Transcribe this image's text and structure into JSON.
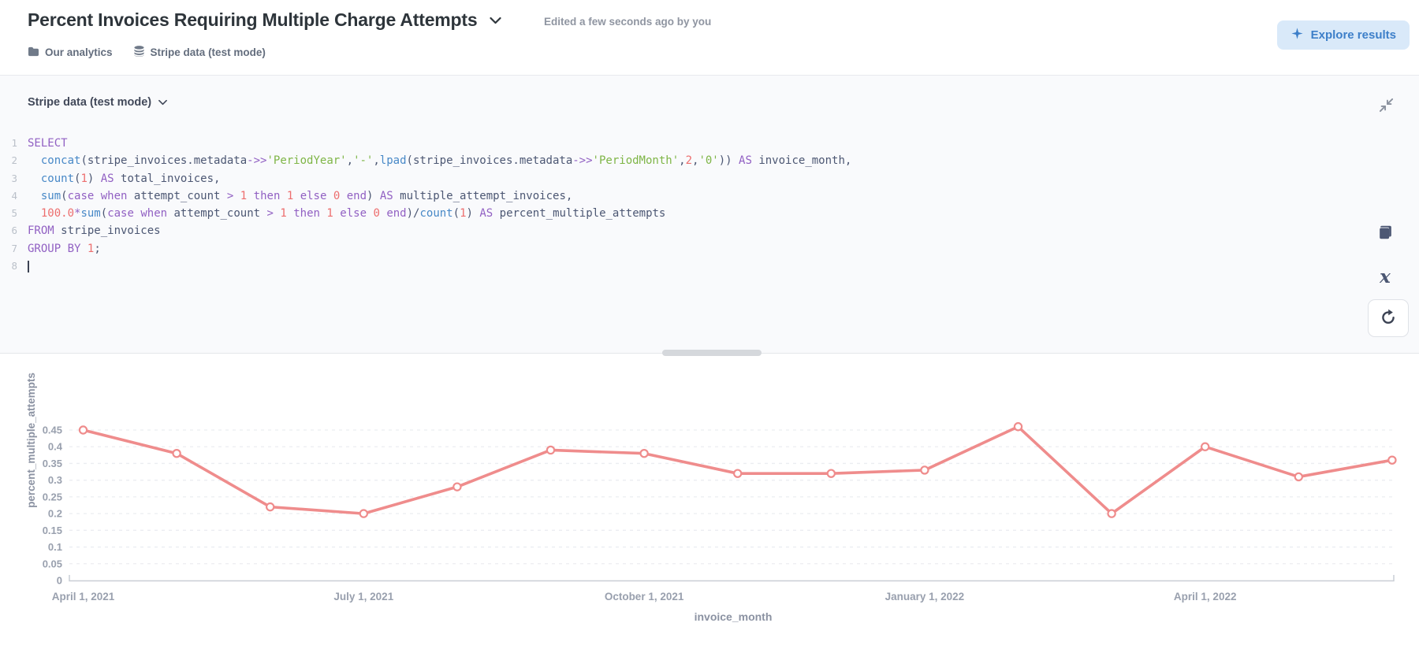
{
  "header": {
    "title": "Percent Invoices Requiring Multiple Charge Attempts",
    "edited_note": "Edited a few seconds ago by you",
    "explore_button_label": "Explore results",
    "breadcrumbs": [
      {
        "icon": "folder",
        "label": "Our analytics"
      },
      {
        "icon": "database",
        "label": "Stripe data (test mode)"
      }
    ]
  },
  "editor": {
    "datasource_label": "Stripe data (test mode)",
    "sql_lines": [
      [
        [
          "k",
          "SELECT"
        ]
      ],
      [
        [
          "p",
          "  "
        ],
        [
          "f",
          "concat"
        ],
        [
          "p",
          "("
        ],
        [
          "p",
          "stripe_invoices.metadata"
        ],
        [
          "o",
          "->>"
        ],
        [
          "s",
          "'PeriodYear'"
        ],
        [
          "p",
          ","
        ],
        [
          "s",
          "'-'"
        ],
        [
          "p",
          ","
        ],
        [
          "f",
          "lpad"
        ],
        [
          "p",
          "("
        ],
        [
          "p",
          "stripe_invoices.metadata"
        ],
        [
          "o",
          "->>"
        ],
        [
          "s",
          "'PeriodMonth'"
        ],
        [
          "p",
          ","
        ],
        [
          "n",
          "2"
        ],
        [
          "p",
          ","
        ],
        [
          "s",
          "'0'"
        ],
        [
          "p",
          ")) "
        ],
        [
          "k",
          "AS"
        ],
        [
          "p",
          " invoice_month,"
        ]
      ],
      [
        [
          "p",
          "  "
        ],
        [
          "f",
          "count"
        ],
        [
          "p",
          "("
        ],
        [
          "n",
          "1"
        ],
        [
          "p",
          ") "
        ],
        [
          "k",
          "AS"
        ],
        [
          "p",
          " total_invoices,"
        ]
      ],
      [
        [
          "p",
          "  "
        ],
        [
          "f",
          "sum"
        ],
        [
          "p",
          "("
        ],
        [
          "k",
          "case"
        ],
        [
          "p",
          " "
        ],
        [
          "k",
          "when"
        ],
        [
          "p",
          " attempt_count "
        ],
        [
          "o",
          ">"
        ],
        [
          "p",
          " "
        ],
        [
          "n",
          "1"
        ],
        [
          "p",
          " "
        ],
        [
          "k",
          "then"
        ],
        [
          "p",
          " "
        ],
        [
          "n",
          "1"
        ],
        [
          "p",
          " "
        ],
        [
          "k",
          "else"
        ],
        [
          "p",
          " "
        ],
        [
          "n",
          "0"
        ],
        [
          "p",
          " "
        ],
        [
          "k",
          "end"
        ],
        [
          "p",
          ") "
        ],
        [
          "k",
          "AS"
        ],
        [
          "p",
          " multiple_attempt_invoices,"
        ]
      ],
      [
        [
          "p",
          "  "
        ],
        [
          "n",
          "100.0"
        ],
        [
          "o",
          "*"
        ],
        [
          "f",
          "sum"
        ],
        [
          "p",
          "("
        ],
        [
          "k",
          "case"
        ],
        [
          "p",
          " "
        ],
        [
          "k",
          "when"
        ],
        [
          "p",
          " attempt_count "
        ],
        [
          "o",
          ">"
        ],
        [
          "p",
          " "
        ],
        [
          "n",
          "1"
        ],
        [
          "p",
          " "
        ],
        [
          "k",
          "then"
        ],
        [
          "p",
          " "
        ],
        [
          "n",
          "1"
        ],
        [
          "p",
          " "
        ],
        [
          "k",
          "else"
        ],
        [
          "p",
          " "
        ],
        [
          "n",
          "0"
        ],
        [
          "p",
          " "
        ],
        [
          "k",
          "end"
        ],
        [
          "p",
          ")/"
        ],
        [
          "f",
          "count"
        ],
        [
          "p",
          "("
        ],
        [
          "n",
          "1"
        ],
        [
          "p",
          ") "
        ],
        [
          "k",
          "AS"
        ],
        [
          "p",
          " percent_multiple_attempts"
        ]
      ],
      [
        [
          "k",
          "FROM"
        ],
        [
          "p",
          " stripe_invoices"
        ]
      ],
      [
        [
          "k",
          "GROUP BY"
        ],
        [
          "p",
          " "
        ],
        [
          "n",
          "1"
        ],
        [
          "p",
          ";"
        ]
      ],
      [
        [
          "cursor",
          ""
        ]
      ]
    ],
    "tool_icons": [
      "data-reference",
      "variables",
      "snippets"
    ],
    "run_icon": "refresh"
  },
  "chart_data": {
    "type": "line",
    "series_name": "percent_multiple_attempts",
    "x": [
      "2021-04",
      "2021-05",
      "2021-06",
      "2021-07",
      "2021-08",
      "2021-09",
      "2021-10",
      "2021-11",
      "2021-12",
      "2022-01",
      "2022-02",
      "2022-03",
      "2022-04",
      "2022-05",
      "2022-06"
    ],
    "values": [
      0.45,
      0.38,
      0.22,
      0.2,
      0.28,
      0.39,
      0.38,
      0.32,
      0.32,
      0.33,
      0.46,
      0.2,
      0.4,
      0.31,
      0.36
    ],
    "xlabel": "invoice_month",
    "ylabel": "percent_multiple_attempts",
    "x_tick_labels": [
      "April 1, 2021",
      "July 1, 2021",
      "October 1, 2021",
      "January 1, 2022",
      "April 1, 2022"
    ],
    "x_tick_indices": [
      0,
      3,
      6,
      9,
      12
    ],
    "y_ticks": [
      0,
      0.05,
      0.1,
      0.15,
      0.2,
      0.25,
      0.3,
      0.35,
      0.4,
      0.45
    ],
    "ylim": [
      0,
      0.475
    ],
    "grid": "dashed-horizontal",
    "legend": "none",
    "line_color": "#EF8C8C",
    "marker": "open-circle"
  },
  "colors": {
    "brand_blue": "#509EE3",
    "accent_line": "#EF8C8C",
    "title_dark": "#2e353b",
    "slate": "#4C5773",
    "tick_gray": "#99a0ae"
  }
}
